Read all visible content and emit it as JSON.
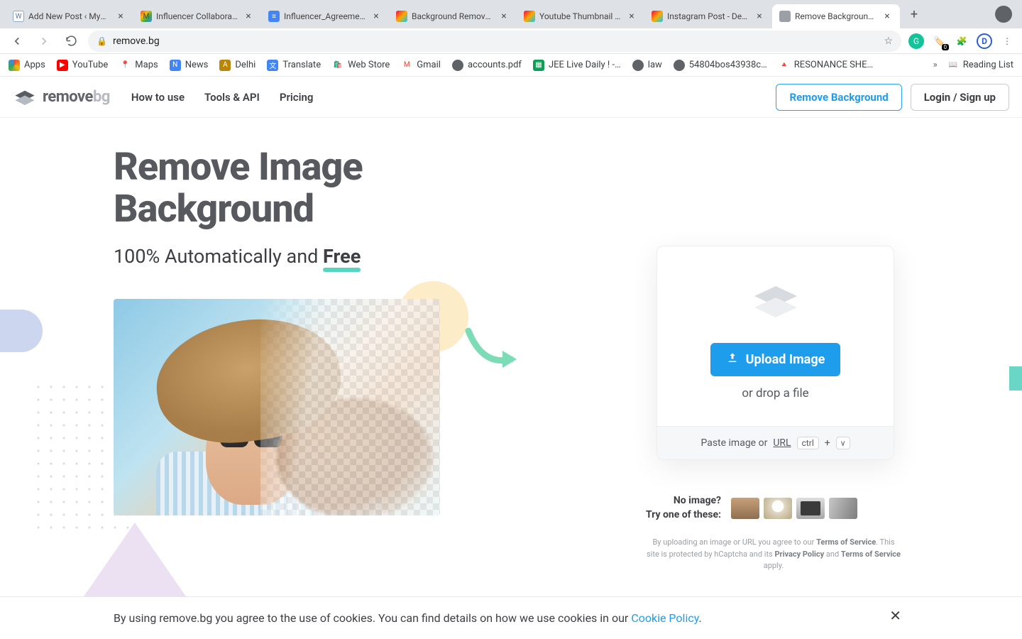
{
  "browser": {
    "tabs": [
      {
        "title": "Add New Post ‹ MyS…"
      },
      {
        "title": "Influencer Collaborati…"
      },
      {
        "title": "Influencer_Agreemen…"
      },
      {
        "title": "Background Remover…"
      },
      {
        "title": "Youtube Thumbnail - …"
      },
      {
        "title": "Instagram Post - Desi…"
      },
      {
        "title": "Remove Background f…"
      }
    ],
    "url": "remove.bg",
    "bookmarks": [
      {
        "label": "Apps"
      },
      {
        "label": "YouTube"
      },
      {
        "label": "Maps"
      },
      {
        "label": "News"
      },
      {
        "label": "Delhi"
      },
      {
        "label": "Translate"
      },
      {
        "label": "Web Store"
      },
      {
        "label": "Gmail"
      },
      {
        "label": "accounts.pdf"
      },
      {
        "label": "JEE Live Daily ! -…"
      },
      {
        "label": "law"
      },
      {
        "label": "54804bos43938c…"
      },
      {
        "label": "RESONANCE SHE…"
      }
    ],
    "overflow_label": "Reading List",
    "ext_badge": "0"
  },
  "site": {
    "logo_main": "remove",
    "logo_suffix": "bg",
    "nav": {
      "how": "How to use",
      "tools": "Tools & API",
      "pricing": "Pricing"
    },
    "cta_primary": "Remove Background",
    "cta_secondary": "Login / Sign up"
  },
  "hero": {
    "title_l1": "Remove Image",
    "title_l2": "Background",
    "sub_pre": "100% Automatically and ",
    "sub_free": "Free"
  },
  "upload": {
    "button": "Upload Image",
    "drop": "or drop a file",
    "paste_pre": "Paste image or ",
    "paste_url": "URL",
    "kbd1": "ctrl",
    "kbd_plus": "+",
    "kbd2": "v"
  },
  "try": {
    "line1": "No image?",
    "line2": "Try one of these:"
  },
  "legal": {
    "t1": "By uploading an image or URL you agree to our ",
    "tos": "Terms of Service",
    "t2": ". This site is protected by hCaptcha and its ",
    "pp": "Privacy Policy",
    "t3": " and ",
    "tos2": "Terms of Service",
    "t4": " apply."
  },
  "cookie": {
    "text": "By using remove.bg you agree to the use of cookies. You can find details on how we use cookies in our ",
    "link": "Cookie Policy",
    "dot": "."
  }
}
